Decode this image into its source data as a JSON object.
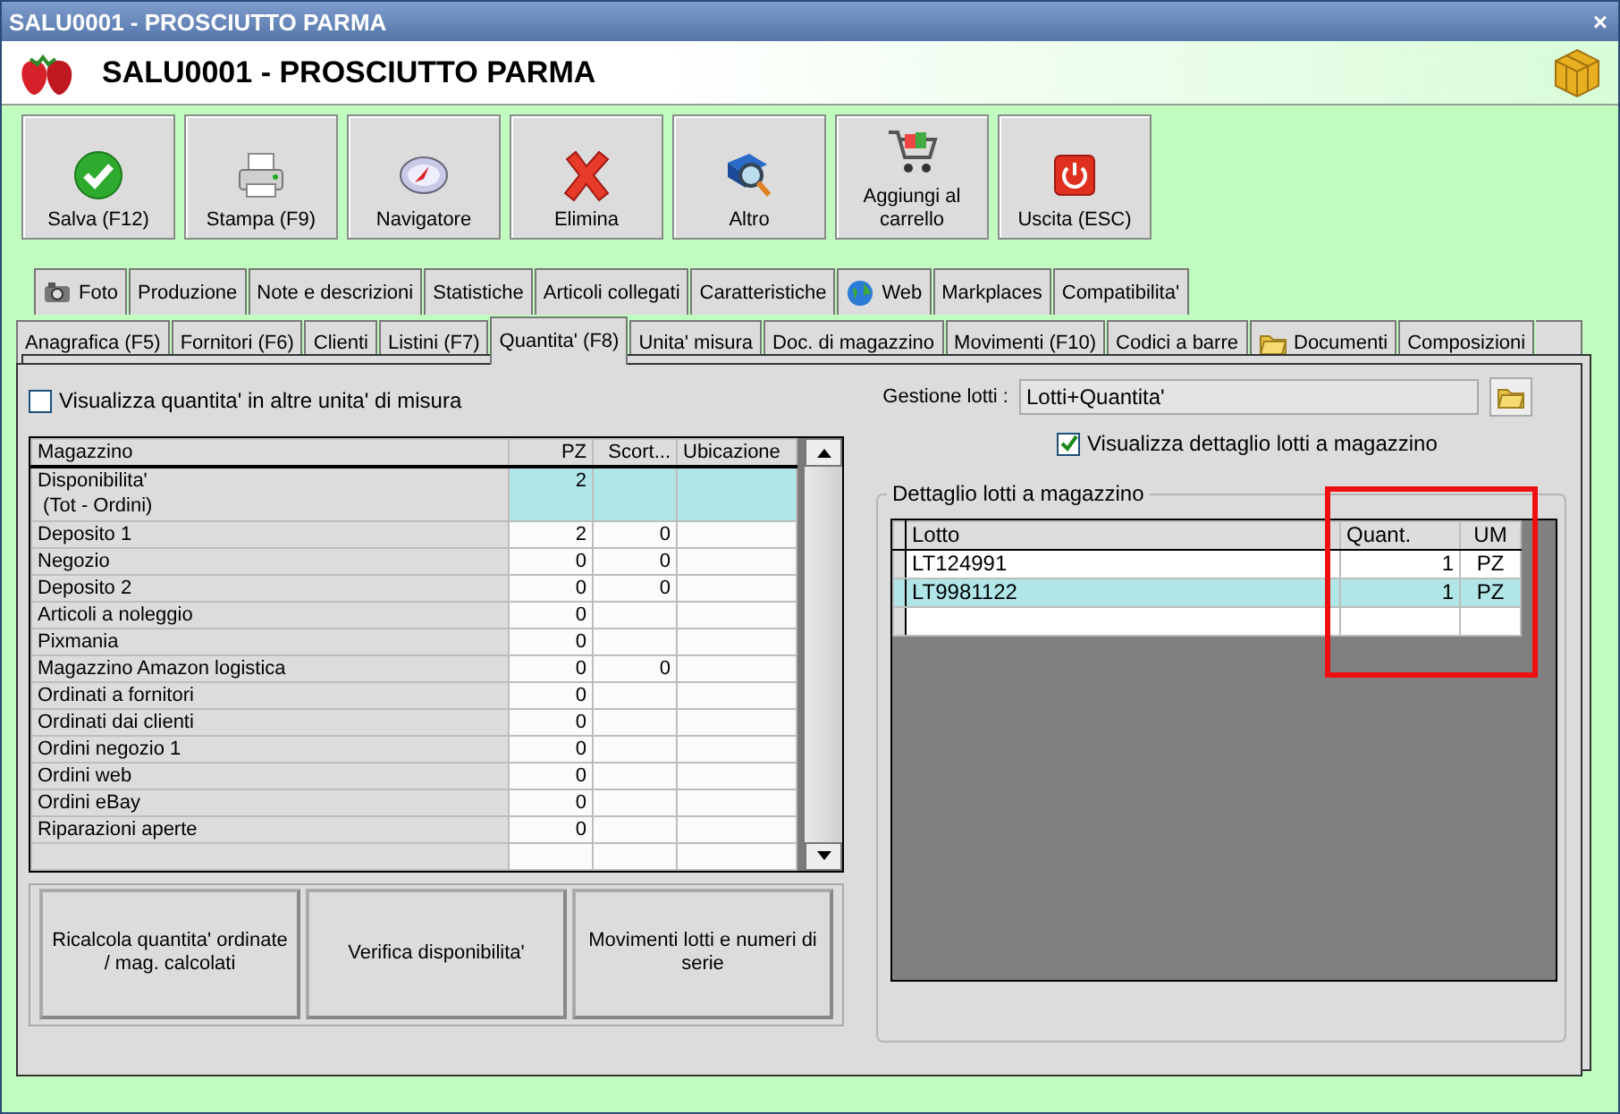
{
  "window": {
    "title": "SALU0001 - PROSCIUTTO PARMA",
    "close": "×"
  },
  "header": {
    "title": "SALU0001 - PROSCIUTTO PARMA"
  },
  "toolbar": [
    {
      "label": "Salva (F12)",
      "kind": "check"
    },
    {
      "label": "Stampa (F9)",
      "kind": "printer"
    },
    {
      "label": "Navigatore",
      "kind": "compass"
    },
    {
      "label": "Elimina",
      "kind": "cross"
    },
    {
      "label": "Altro",
      "kind": "book"
    },
    {
      "label": "Aggiungi al carrello",
      "kind": "cart"
    },
    {
      "label": "Uscita (ESC)",
      "kind": "power"
    }
  ],
  "tabs_row_1": [
    {
      "label": "Foto",
      "kind": "camera"
    },
    {
      "label": "Produzione",
      "kind": "plain"
    },
    {
      "label": "Note e descrizioni",
      "kind": "plain"
    },
    {
      "label": "Statistiche",
      "kind": "plain"
    },
    {
      "label": "Articoli collegati",
      "kind": "plain"
    },
    {
      "label": "Caratteristiche",
      "kind": "plain"
    },
    {
      "label": "Web",
      "kind": "globe"
    },
    {
      "label": "Markplaces",
      "kind": "plain"
    },
    {
      "label": "Compatibilita'",
      "kind": "plain"
    }
  ],
  "tabs_row_2": [
    {
      "label": "Anagrafica (F5)",
      "kind": "plain",
      "selected": false
    },
    {
      "label": "Fornitori (F6)",
      "kind": "plain",
      "selected": false
    },
    {
      "label": "Clienti",
      "kind": "plain",
      "selected": false
    },
    {
      "label": "Listini (F7)",
      "kind": "plain",
      "selected": false
    },
    {
      "label": "Quantita' (F8)",
      "kind": "plain",
      "selected": true
    },
    {
      "label": "Unita' misura",
      "kind": "plain",
      "selected": false
    },
    {
      "label": "Doc. di magazzino",
      "kind": "plain",
      "selected": false
    },
    {
      "label": "Movimenti (F10)",
      "kind": "plain",
      "selected": false
    },
    {
      "label": "Codici a barre",
      "kind": "plain",
      "selected": false
    },
    {
      "label": "Documenti",
      "kind": "folder",
      "selected": false
    },
    {
      "label": "Composizioni",
      "kind": "plain",
      "selected": false
    }
  ],
  "quantity_panel": {
    "checkbox": {
      "label": "Visualizza quantita' in altre unita' di misura",
      "checked": false
    },
    "table": {
      "columns": [
        "Magazzino",
        "PZ",
        "Scort...",
        "Ubicazione"
      ],
      "rows": [
        {
          "name": "Disponibilita'\n (Tot - Ordini)",
          "pz": "2",
          "selected": true
        },
        {
          "name": "Deposito 1",
          "pz": "2",
          "scorta": "0",
          "selected": false
        },
        {
          "name": "Negozio",
          "pz": "0",
          "scorta": "0",
          "selected": false
        },
        {
          "name": "Deposito 2",
          "pz": "0",
          "scorta": "0",
          "selected": false
        },
        {
          "name": "Articoli a noleggio",
          "pz": "0",
          "selected": false
        },
        {
          "name": "Pixmania",
          "pz": "0",
          "selected": false
        },
        {
          "name": "Magazzino Amazon logistica",
          "pz": "0",
          "scorta": "0",
          "selected": false
        },
        {
          "name": "Ordinati a fornitori",
          "pz": "0",
          "selected": false
        },
        {
          "name": "Ordinati dai clienti",
          "pz": "0",
          "selected": false
        },
        {
          "name": "Ordini negozio 1",
          "pz": "0",
          "selected": false
        },
        {
          "name": "Ordini web",
          "pz": "0",
          "selected": false
        },
        {
          "name": "Ordini eBay",
          "pz": "0",
          "selected": false
        },
        {
          "name": "Riparazioni aperte",
          "pz": "0",
          "selected": false
        }
      ]
    },
    "buttons": [
      "Ricalcola quantita' ordinate / mag. calcolati",
      "Verifica disponibilita'",
      "Movimenti lotti e numeri di serie"
    ]
  },
  "lots_panel": {
    "label": "Gestione lotti :",
    "value": "Lotti+Quantita'",
    "checkbox": {
      "label": "Visualizza dettaglio lotti a magazzino",
      "checked": true
    },
    "group_title": "Dettaglio lotti a magazzino",
    "table": {
      "columns": [
        "Lotto",
        "Quant.",
        "UM"
      ],
      "rows": [
        {
          "lotto": "LT124991",
          "quant": "1",
          "um": "PZ",
          "selected": false
        },
        {
          "lotto": "LT9981122",
          "quant": "1",
          "um": "PZ",
          "selected": true
        }
      ]
    }
  },
  "annotations": [
    {
      "kind": "frame"
    }
  ]
}
